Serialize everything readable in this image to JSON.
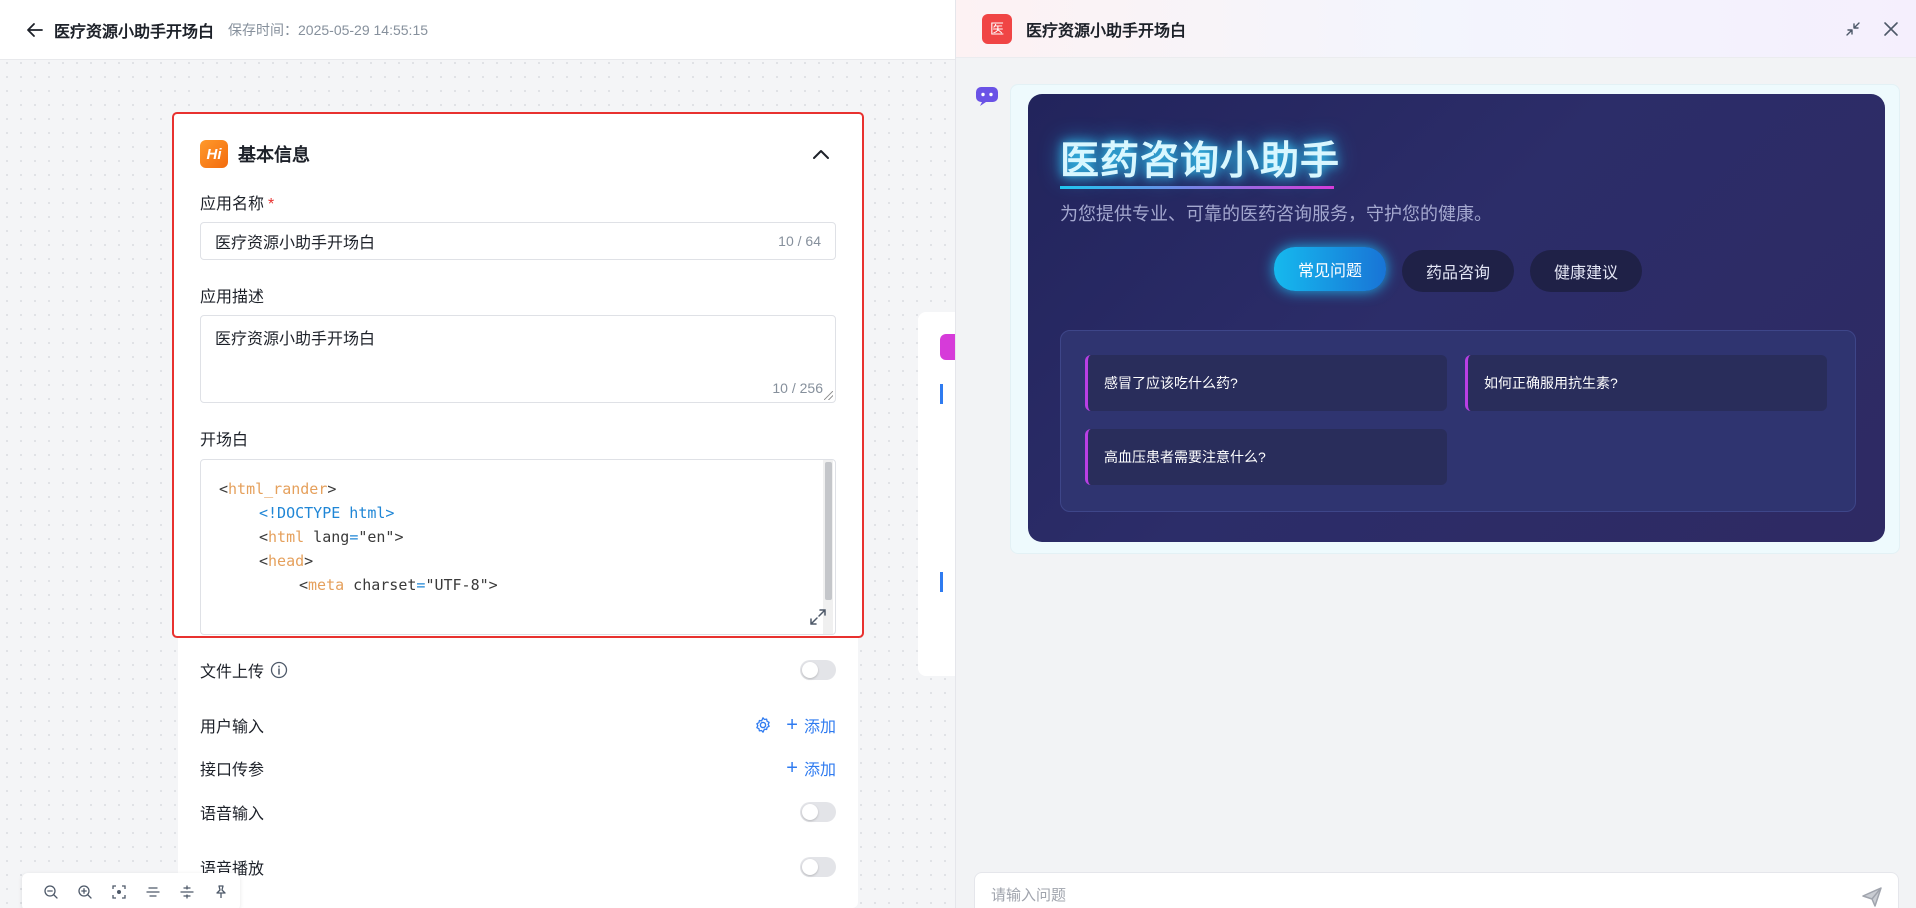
{
  "header": {
    "title": "医疗资源小助手开场白",
    "save_time": "保存时间：2025-05-29 14:55:15"
  },
  "basic_info": {
    "title": "基本信息",
    "icon_text": "Hi",
    "app_name_label": "应用名称",
    "required_mark": "*",
    "app_name_value": "医疗资源小助手开场白",
    "app_name_counter": "10 / 64",
    "app_desc_label": "应用描述",
    "app_desc_value": "医疗资源小助手开场白",
    "app_desc_counter": "10 / 256",
    "opening_label": "开场白",
    "code_lines": [
      {
        "lt": "<",
        "tag": "html_rander",
        "gt": ">"
      },
      {
        "text": "<!DOCTYPE html>"
      },
      {
        "lt": "<",
        "tag": "html",
        "attr": " lang",
        "eq": "=",
        "val": "\"en\"",
        "gt": ">"
      },
      {
        "lt": "<",
        "tag": "head",
        "gt": ">"
      },
      {
        "lt": "<",
        "tag": "meta",
        "attr": " charset",
        "eq": "=",
        "val": "\"UTF-8\"",
        "gt": ">"
      }
    ]
  },
  "settings": {
    "file_upload": "文件上传",
    "user_input": "用户输入",
    "api_params": "接口传参",
    "voice_input": "语音输入",
    "voice_play": "语音播放",
    "add_label": "添加",
    "plus": "+"
  },
  "zoom_bar": {
    "buttons": [
      "zoom-out",
      "zoom-in",
      "fit-view",
      "align-horizontal",
      "align-vertical",
      "pin"
    ]
  },
  "preview": {
    "badge": "医",
    "title": "医疗资源小助手开场白",
    "hero_title": "医药咨询小助手",
    "hero_subtitle": "为您提供专业、可靠的医药咨询服务，守护您的健康。",
    "tabs": [
      "常见问题",
      "药品咨询",
      "健康建议"
    ],
    "questions": [
      "感冒了应该吃什么药?",
      "如何正确服用抗生素?",
      "高血压患者需要注意什么?"
    ],
    "input_placeholder": "请输入问题"
  },
  "colors": {
    "accent": "#2f7bf0",
    "highlight_border": "#e8312f",
    "hero_bg": "#22245c",
    "tab_active": "#16b9ee"
  }
}
